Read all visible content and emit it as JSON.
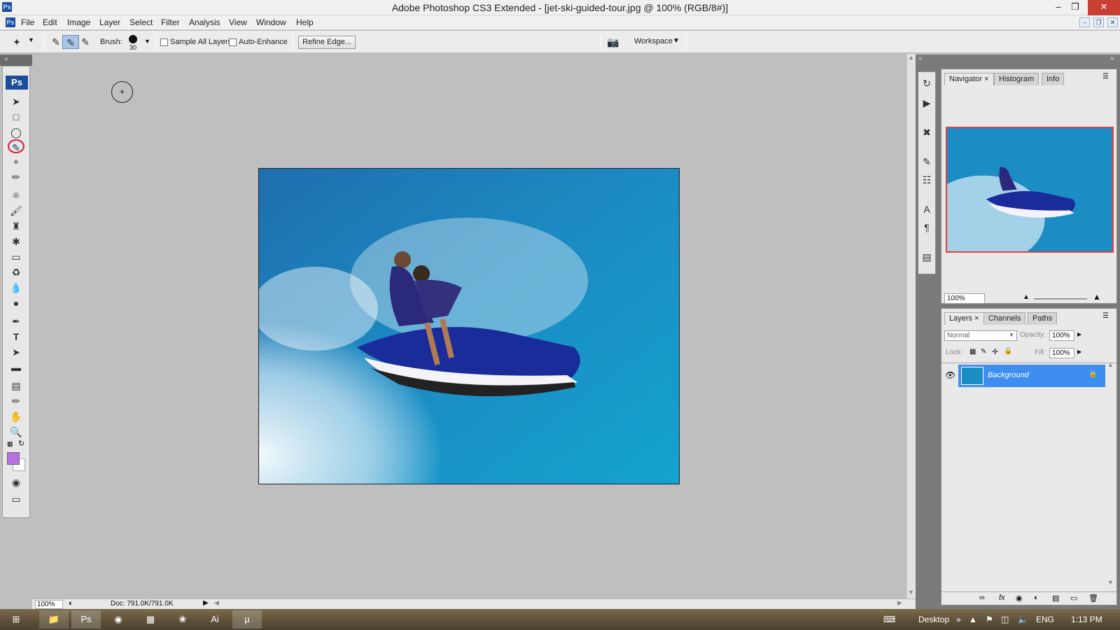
{
  "window": {
    "title": "Adobe Photoshop CS3 Extended - [jet-ski-guided-tour.jpg @ 100% (RGB/8#)]",
    "app_logo": "Ps",
    "minimize_icon": "minimize-icon",
    "maximize_icon": "restore-icon",
    "close_icon": "close-icon"
  },
  "menu": {
    "items": [
      "File",
      "Edit",
      "Image",
      "Layer",
      "Select",
      "Filter",
      "Analysis",
      "View",
      "Window",
      "Help"
    ]
  },
  "options_bar": {
    "brush_label": "Brush:",
    "brush_size": "30",
    "sample_all_layers": {
      "label": "Sample All Layers",
      "checked": false
    },
    "auto_enhance": {
      "label": "Auto-Enhance",
      "checked": false
    },
    "refine_edge_button": "Refine Edge...",
    "workspace_label": "Workspace"
  },
  "toolbox": {
    "logo": "Ps",
    "tools": [
      "move-tool-icon",
      "rectangular-marquee-tool-icon",
      "lasso-tool-icon",
      "quick-selection-tool-icon",
      "crop-tool-icon",
      "slice-tool-icon",
      "healing-brush-tool-icon",
      "brush-tool-icon",
      "clone-stamp-tool-icon",
      "history-brush-tool-icon",
      "eraser-tool-icon",
      "paint-bucket-tool-icon",
      "blur-tool-icon",
      "dodge-tool-icon",
      "pen-tool-icon",
      "type-tool-icon",
      "path-selection-tool-icon",
      "rectangle-tool-icon",
      "notes-tool-icon",
      "eyedropper-tool-icon",
      "hand-tool-icon",
      "zoom-tool-icon"
    ],
    "foreground_color": "#b86fe0",
    "background_color": "#ffffff",
    "highlight_color": "#e02020"
  },
  "status_bar": {
    "zoom": "100%",
    "doc_info": "Doc: 791.0K/791.0K"
  },
  "navigator_panel": {
    "tabs": [
      "Navigator",
      "Histogram",
      "Info"
    ],
    "active_tab": "Navigator",
    "zoom": "100%",
    "view_box_color": "#e04040"
  },
  "layers_panel": {
    "tabs": [
      "Layers",
      "Channels",
      "Paths"
    ],
    "active_tab": "Layers",
    "blend_mode": "Normal",
    "opacity_label": "Opacity:",
    "opacity": "100%",
    "lock_label": "Lock:",
    "fill_label": "Fill:",
    "fill": "100%",
    "layers": [
      {
        "name": "Background",
        "visible": true,
        "locked": true,
        "selected": true
      }
    ],
    "selected_color": "#3e8ef0"
  },
  "taskbar": {
    "apps": [
      "file-explorer-icon",
      "photoshop-icon",
      "chrome-icon",
      "office-icon",
      "acrobat-icon",
      "illustrator-icon",
      "utorrent-icon"
    ],
    "desktop_label": "Desktop",
    "language": "ENG",
    "time": "1:13 PM"
  },
  "colors": {
    "canvas_bg": "#bfbfbf",
    "panel_bg": "#e9e9e9",
    "dock_bg": "#7a7a7a"
  }
}
